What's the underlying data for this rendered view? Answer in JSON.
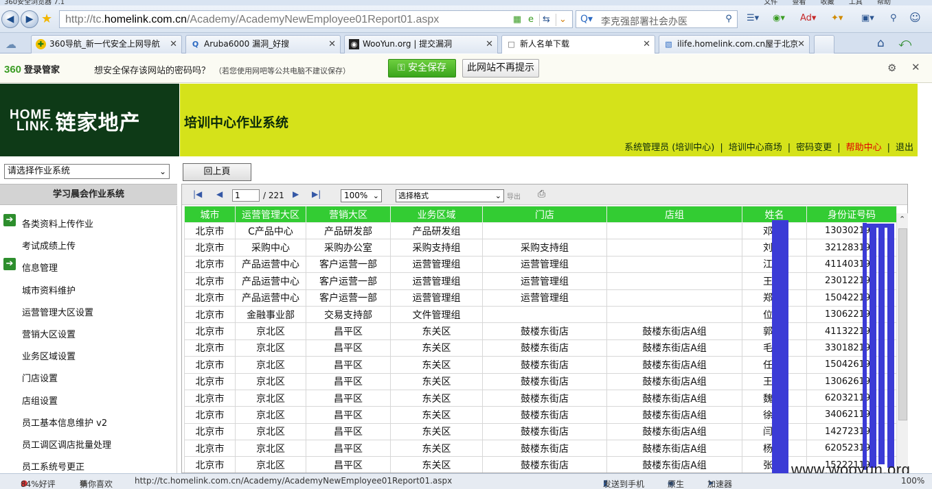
{
  "browser": {
    "window_title": "360安全浏览器 7.1",
    "menus": [
      "文件",
      "查看",
      "收藏",
      "工具",
      "帮助"
    ],
    "url_prefix": "http://tc.",
    "url_domain": "homelink.com.cn",
    "url_path": "/Academy/AcademyNewEmployee01Report01.aspx",
    "search_placeholder": "李克强部署社会办医",
    "tabs": [
      {
        "label": "360导航_新一代安全上网导航"
      },
      {
        "label": "Aruba6000 漏洞_好搜"
      },
      {
        "label": "WooYun.org | 提交漏洞"
      },
      {
        "label": "新人名单下载"
      },
      {
        "label": "ilife.homelink.com.cn屋于北京"
      }
    ]
  },
  "password_bar": {
    "logo": "360",
    "logo_sub": "登录管家",
    "message": "想安全保存该网站的密码吗？",
    "note": "（若您使用网吧等公共电脑不建议保存）",
    "save_label": "安全保存",
    "never_label": "此网站不再提示"
  },
  "header": {
    "logo_en_top": "HOME",
    "logo_en_bottom": "LINK.",
    "logo_cn": "链家地产",
    "system_title": "培训中心作业系统",
    "links": {
      "admin": "系统管理员 (培训中心)",
      "mall": "培训中心商场",
      "password": "密码变更",
      "help": "帮助中心",
      "logout": "退出"
    },
    "colors": {
      "brand_dark": "#0e3a17",
      "brand_yellow": "#d5e21a",
      "help_red": "#e00000"
    }
  },
  "sidebar": {
    "select_value": "请选择作业系统",
    "heading": "学习晨会作业系统",
    "items": [
      {
        "label": "各类资料上传作业",
        "group": true
      },
      {
        "label": "考试成绩上传",
        "group": false
      },
      {
        "label": "信息管理",
        "group": true
      },
      {
        "label": "城市资料维护",
        "group": false
      },
      {
        "label": "运营管理大区设置",
        "group": false
      },
      {
        "label": "营销大区设置",
        "group": false
      },
      {
        "label": "业务区域设置",
        "group": false
      },
      {
        "label": "门店设置",
        "group": false
      },
      {
        "label": "店组设置",
        "group": false
      },
      {
        "label": "员工基本信息维护 v2",
        "group": false
      },
      {
        "label": "员工调区调店批量处理",
        "group": false
      },
      {
        "label": "员工系统号更正",
        "group": false
      }
    ]
  },
  "main": {
    "back_label": "回上頁",
    "toolbar": {
      "page": "1",
      "total": "/ 221",
      "zoom": "100%",
      "format": "选择格式",
      "export": "导出"
    },
    "table": {
      "header_color": "#33cc33",
      "columns": [
        "城市",
        "运营管理大区",
        "营销大区",
        "业务区域",
        "门店",
        "店组",
        "姓名",
        "身份证号码"
      ],
      "rows": [
        [
          "北京市",
          "C产品中心",
          "产品研发部",
          "产品研发组",
          "",
          "",
          "邓",
          "130302197"
        ],
        [
          "北京市",
          "采购中心",
          "采购办公室",
          "采购支持组",
          "采购支持组",
          "",
          "刘",
          "321283198"
        ],
        [
          "北京市",
          "产品运营中心",
          "客户运营一部",
          "运营管理组",
          "运营管理组",
          "",
          "江",
          "411403198"
        ],
        [
          "北京市",
          "产品运营中心",
          "客户运营一部",
          "运营管理组",
          "运营管理组",
          "",
          "王",
          "230122198"
        ],
        [
          "北京市",
          "产品运营中心",
          "客户运营一部",
          "运营管理组",
          "运营管理组",
          "",
          "郑",
          "150422198"
        ],
        [
          "北京市",
          "金融事业部",
          "交易支持部",
          "文件管理组",
          "",
          "",
          "位",
          "130622198"
        ],
        [
          "北京市",
          "京北区",
          "昌平区",
          "东关区",
          "鼓楼东街店",
          "鼓楼东街店A组",
          "郭",
          "411322198"
        ],
        [
          "北京市",
          "京北区",
          "昌平区",
          "东关区",
          "鼓楼东街店",
          "鼓楼东街店A组",
          "毛",
          "330182198"
        ],
        [
          "北京市",
          "京北区",
          "昌平区",
          "东关区",
          "鼓楼东街店",
          "鼓楼东街店A组",
          "任",
          "150426198"
        ],
        [
          "北京市",
          "京北区",
          "昌平区",
          "东关区",
          "鼓楼东街店",
          "鼓楼东街店A组",
          "王",
          "130626198"
        ],
        [
          "北京市",
          "京北区",
          "昌平区",
          "东关区",
          "鼓楼东街店",
          "鼓楼东街店A组",
          "魏",
          "620321198"
        ],
        [
          "北京市",
          "京北区",
          "昌平区",
          "东关区",
          "鼓楼东街店",
          "鼓楼东街店A组",
          "徐",
          "340621198"
        ],
        [
          "北京市",
          "京北区",
          "昌平区",
          "东关区",
          "鼓楼东街店",
          "鼓楼东街店A组",
          "闫",
          "142723198"
        ],
        [
          "北京市",
          "京北区",
          "昌平区",
          "东关区",
          "鼓楼东街店",
          "鼓楼东街店A组",
          "杨",
          "620523198"
        ],
        [
          "北京市",
          "京北区",
          "昌平区",
          "东关区",
          "鼓楼东街店",
          "鼓楼东街店A组",
          "张",
          "152221198"
        ]
      ]
    }
  },
  "watermark": "www.wooyun.org",
  "statusbar": {
    "rating": "84%好评",
    "guess": "猜你喜欢",
    "url": "http://tc.homelink.com.cn/Academy/AcademyNewEmployee01Report01.aspx",
    "send": "发送到手机",
    "cache": "原生",
    "accel": "加速器",
    "zoom": "100%"
  }
}
